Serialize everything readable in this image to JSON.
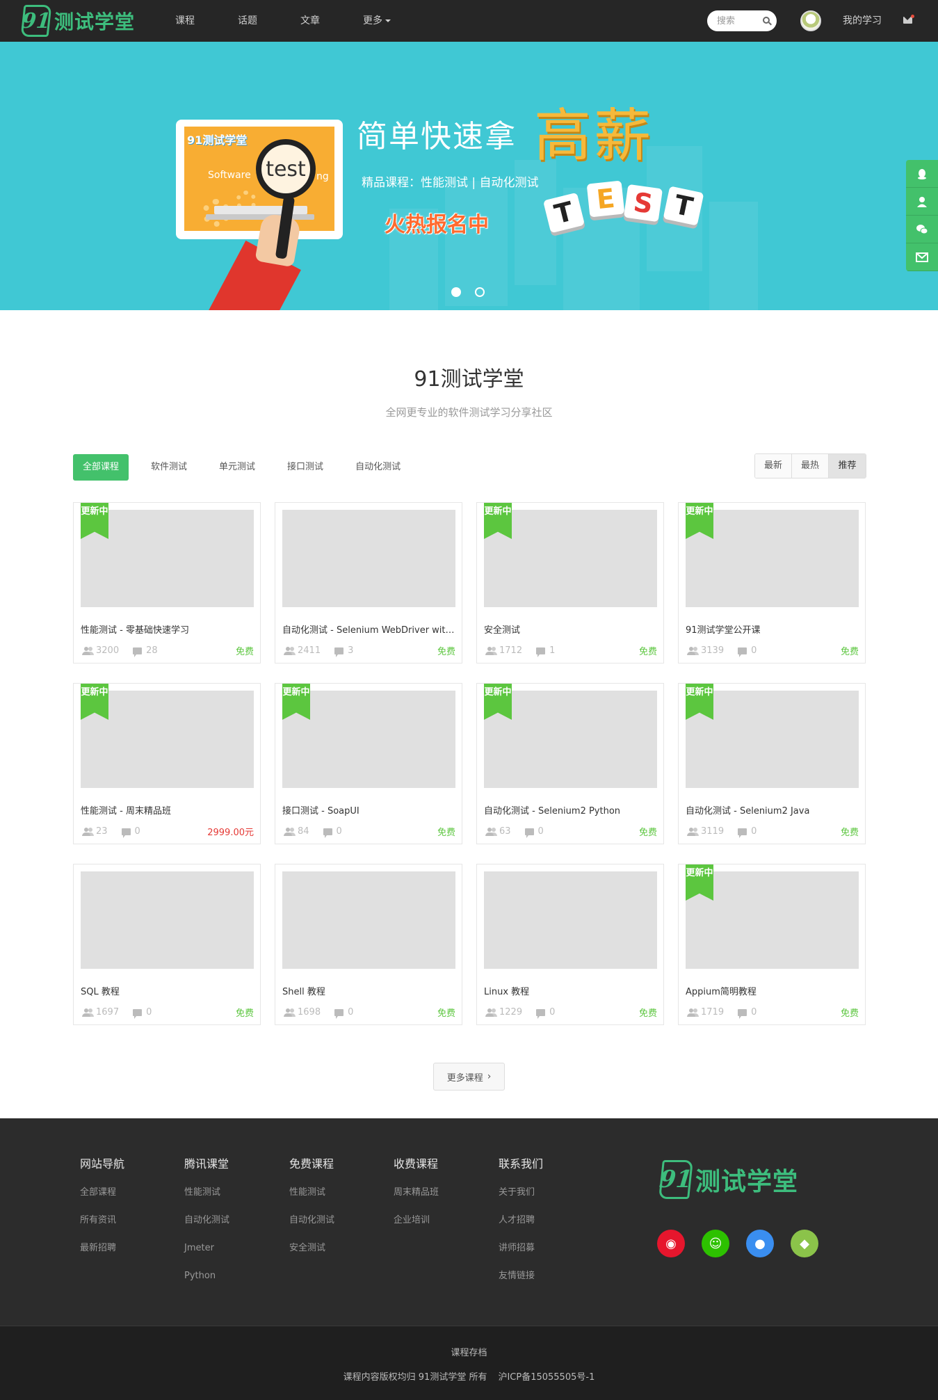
{
  "brand": {
    "logo_mark": "91",
    "name": "测试学堂"
  },
  "nav": {
    "items": [
      "课程",
      "话题",
      "文章",
      "更多"
    ]
  },
  "search": {
    "placeholder": "搜索"
  },
  "user": {
    "my_study": "我的学习"
  },
  "banner": {
    "screen_brand": "91测试学堂",
    "screen_word": "Software",
    "lens_text": "test",
    "lens_tail": "ng",
    "headline": "简单快速拿",
    "headline_big": "高薪",
    "subline": "精品课程：性能测试 | 自动化测试",
    "hot": "火热报名中",
    "tiles": [
      "T",
      "E",
      "S",
      "T"
    ],
    "tile_colors": [
      "#222222",
      "#f5a623",
      "#e53935",
      "#222222"
    ],
    "slides": 2,
    "active_slide": 1,
    "background": "#40c8d4"
  },
  "side_toolbar": {
    "icons": [
      "qq-icon",
      "support-icon",
      "wechat-icon",
      "mail-icon"
    ]
  },
  "section": {
    "title": "91测试学堂",
    "subtitle": "全网更专业的软件测试学习分享社区"
  },
  "categories": [
    "全部课程",
    "软件测试",
    "单元测试",
    "接口测试",
    "自动化测试"
  ],
  "sort": [
    "最新",
    "最热",
    "推荐"
  ],
  "ribbon_text": "更新中",
  "courses": [
    {
      "title": "性能测试 - 零基础快速学习",
      "students": "3200",
      "comments": "28",
      "price": "免费",
      "updating": true,
      "paid": false
    },
    {
      "title": "自动化测试 - Selenium WebDriver wit…",
      "students": "2411",
      "comments": "3",
      "price": "免费",
      "updating": false,
      "paid": false
    },
    {
      "title": "安全测试",
      "students": "1712",
      "comments": "1",
      "price": "免费",
      "updating": true,
      "paid": false
    },
    {
      "title": "91测试学堂公开课",
      "students": "3139",
      "comments": "0",
      "price": "免费",
      "updating": true,
      "paid": false
    },
    {
      "title": "性能测试 - 周末精品班",
      "students": "23",
      "comments": "0",
      "price": "2999.00元",
      "updating": true,
      "paid": true
    },
    {
      "title": "接口测试 - SoapUI",
      "students": "84",
      "comments": "0",
      "price": "免费",
      "updating": true,
      "paid": false
    },
    {
      "title": "自动化测试 - Selenium2 Python",
      "students": "63",
      "comments": "0",
      "price": "免费",
      "updating": true,
      "paid": false
    },
    {
      "title": "自动化测试 - Selenium2 Java",
      "students": "3119",
      "comments": "0",
      "price": "免费",
      "updating": true,
      "paid": false
    },
    {
      "title": "SQL 教程",
      "students": "1697",
      "comments": "0",
      "price": "免费",
      "updating": false,
      "paid": false
    },
    {
      "title": "Shell 教程",
      "students": "1698",
      "comments": "0",
      "price": "免费",
      "updating": false,
      "paid": false
    },
    {
      "title": "Linux 教程",
      "students": "1229",
      "comments": "0",
      "price": "免费",
      "updating": false,
      "paid": false
    },
    {
      "title": "Appium简明教程",
      "students": "1719",
      "comments": "0",
      "price": "免费",
      "updating": true,
      "paid": false
    }
  ],
  "more_button": "更多课程",
  "footer": {
    "columns": [
      {
        "title": "网站导航",
        "links": [
          "全部课程",
          "所有资讯",
          "最新招聘"
        ]
      },
      {
        "title": "腾讯课堂",
        "links": [
          "性能测试",
          "自动化测试",
          "Jmeter",
          "Python"
        ]
      },
      {
        "title": "免费课程",
        "links": [
          "性能测试",
          "自动化测试",
          "安全测试"
        ]
      },
      {
        "title": "收费课程",
        "links": [
          "周末精品班",
          "企业培训"
        ]
      },
      {
        "title": "联系我们",
        "links": [
          "关于我们",
          "人才招聘",
          "讲师招募",
          "友情链接"
        ]
      }
    ],
    "social": [
      {
        "name": "weibo-icon",
        "color": "#e6162d",
        "glyph": "◉"
      },
      {
        "name": "wechat-icon",
        "color": "#2dc100",
        "glyph": "☺"
      },
      {
        "name": "apple-icon",
        "color": "#3a8ef0",
        "glyph": "●"
      },
      {
        "name": "android-icon",
        "color": "#8bc34a",
        "glyph": "◆"
      }
    ],
    "archive": "课程存档",
    "copyright": "课程内容版权均归 91测试学堂 所有",
    "icp": "沪ICP备15055505号-1"
  },
  "colors": {
    "accent": "#43c16b",
    "paid": "#e53935",
    "free": "#5cc63f",
    "header_bg": "#262626",
    "footer_bg": "#2c2c2c"
  }
}
